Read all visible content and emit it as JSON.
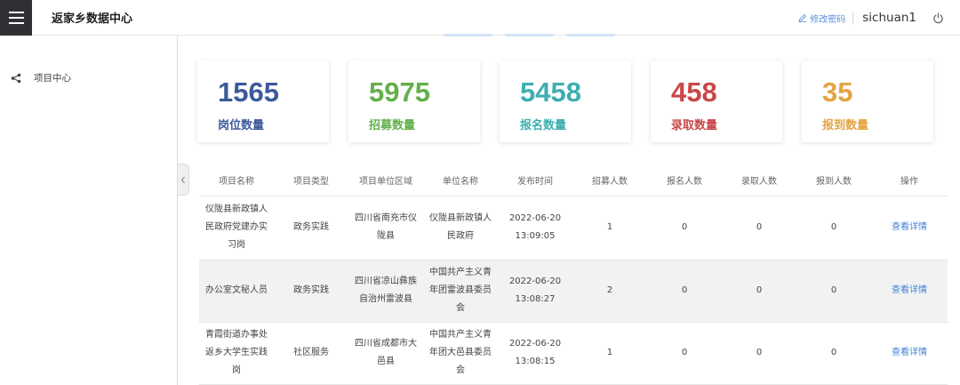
{
  "header": {
    "title": "返家乡数据中心",
    "change_password": "修改密码",
    "username": "sichuan1"
  },
  "sidebar": {
    "items": [
      {
        "label": "项目中心",
        "icon": "share-icon"
      }
    ]
  },
  "stats": [
    {
      "value": "1565",
      "label": "岗位数量",
      "color": "#3d5a9a"
    },
    {
      "value": "5975",
      "label": "招募数量",
      "color": "#62b04a"
    },
    {
      "value": "5458",
      "label": "报名数量",
      "color": "#3eaeb0"
    },
    {
      "value": "458",
      "label": "录取数量",
      "color": "#c9474a"
    },
    {
      "value": "35",
      "label": "报到数量",
      "color": "#e3a444"
    }
  ],
  "table": {
    "columns": [
      "项目名称",
      "项目类型",
      "项目单位区域",
      "单位名称",
      "发布时间",
      "招募人数",
      "报名人数",
      "录取人数",
      "报到人数",
      "操作"
    ],
    "rows": [
      [
        "仪陇县新政镇人民政府党建办实习岗",
        "政务实践",
        "四川省南充市仪陇县",
        "仪陇县新政镇人民政府",
        "2022-06-20 13:09:05",
        "1",
        "0",
        "0",
        "0",
        "查看详情"
      ],
      [
        "办公室文秘人员",
        "政务实践",
        "四川省凉山彝族自治州雷波县",
        "中国共产主义青年团雷波县委员会",
        "2022-06-20 13:08:27",
        "2",
        "0",
        "0",
        "0",
        "查看详情"
      ],
      [
        "青霞街道办事处 返乡大学生实践岗",
        "社区服务",
        "四川省成都市大邑县",
        "中国共产主义青年团大邑县委员会",
        "2022-06-20 13:08:15",
        "1",
        "0",
        "0",
        "0",
        "查看详情"
      ]
    ]
  },
  "colors": {
    "accent": "#3f83d6",
    "header_dark": "#2f3033"
  }
}
